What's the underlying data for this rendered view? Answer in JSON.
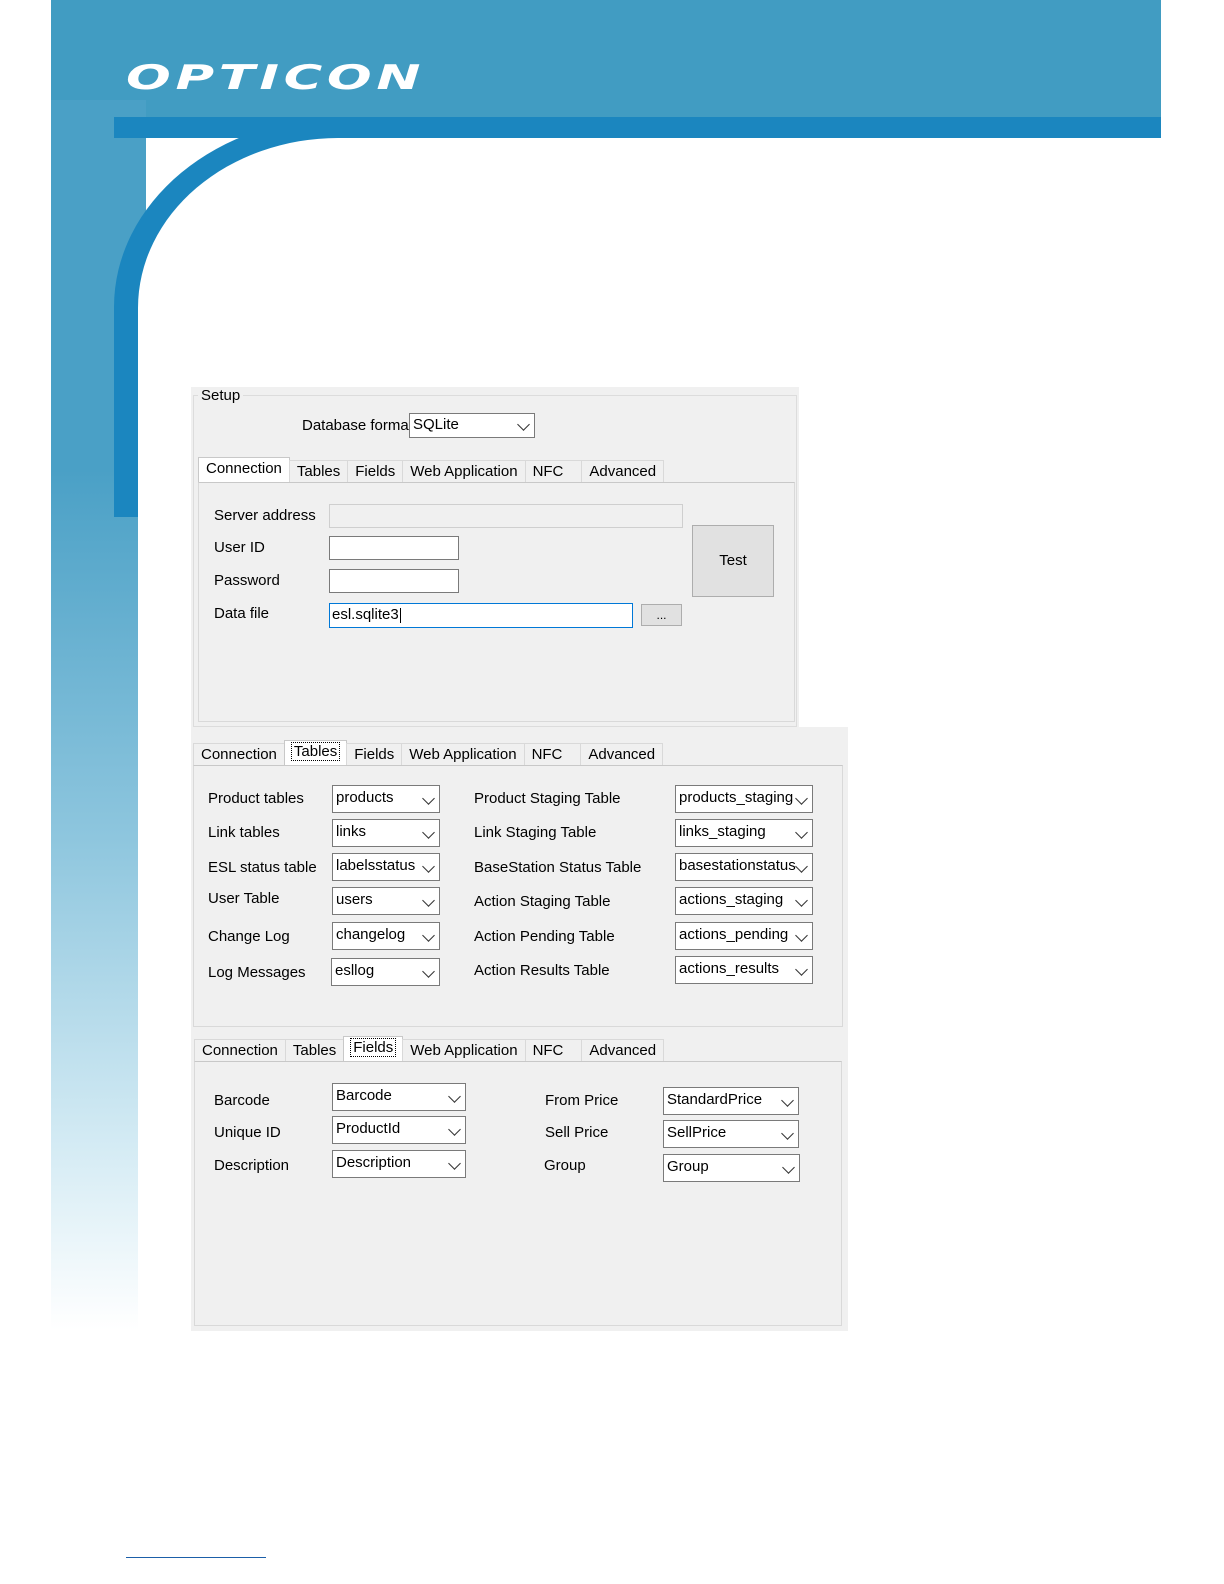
{
  "brand": {
    "logo_text": "OPTICON"
  },
  "setup": {
    "group_label": "Setup",
    "database_format_label": "Database format",
    "database_format_value": "SQLite"
  },
  "tabs": [
    "Connection",
    "Tables",
    "Fields",
    "Web Application",
    "NFC",
    "Advanced"
  ],
  "connection": {
    "server_address_label": "Server address",
    "server_address_value": "",
    "user_id_label": "User ID",
    "user_id_value": "",
    "password_label": "Password",
    "password_value": "",
    "data_file_label": "Data file",
    "data_file_value": "esl.sqlite3",
    "browse_label": "...",
    "test_label": "Test"
  },
  "tables": {
    "left": [
      {
        "label": "Product tables",
        "value": "products"
      },
      {
        "label": "Link tables",
        "value": "links"
      },
      {
        "label": "ESL status table",
        "value": "labelsstatus"
      },
      {
        "label": "User Table",
        "value": "users"
      },
      {
        "label": "Change Log",
        "value": "changelog"
      },
      {
        "label": "Log Messages",
        "value": "esllog"
      }
    ],
    "right": [
      {
        "label": "Product Staging Table",
        "value": "products_staging"
      },
      {
        "label": "Link Staging Table",
        "value": "links_staging"
      },
      {
        "label": "BaseStation Status Table",
        "value": "basestationstatus"
      },
      {
        "label": "Action Staging Table",
        "value": "actions_staging"
      },
      {
        "label": "Action Pending Table",
        "value": "actions_pending"
      },
      {
        "label": "Action Results Table",
        "value": "actions_results"
      }
    ]
  },
  "fields": {
    "left": [
      {
        "label": "Barcode",
        "value": "Barcode"
      },
      {
        "label": "Unique ID",
        "value": "ProductId"
      },
      {
        "label": "Description",
        "value": "Description"
      }
    ],
    "right": [
      {
        "label": "From Price",
        "value": "StandardPrice"
      },
      {
        "label": "Sell Price",
        "value": "SellPrice"
      },
      {
        "label": "Group",
        "value": "Group"
      }
    ]
  }
}
